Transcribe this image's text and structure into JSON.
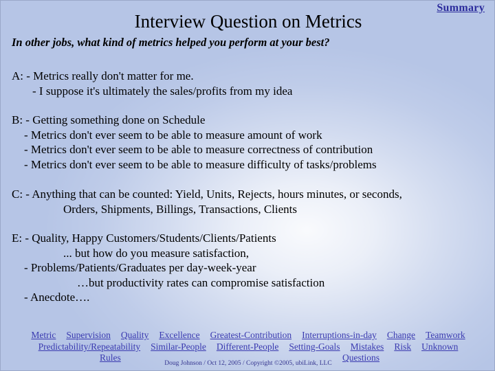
{
  "header": {
    "title": "Interview Question on Metrics",
    "summary_link": "Summary",
    "subtitle": "In other jobs, what kind of metrics helped you perform at your best?"
  },
  "body": {
    "block_a": {
      "lines": [
        "A: - Metrics really don't matter for me.",
        "- I suppose it's ultimately the sales/profits from my idea"
      ]
    },
    "block_b": {
      "lines": [
        "B: - Getting something done on Schedule",
        "- Metrics don't ever seem to be able to measure amount of work",
        "- Metrics don't ever seem to be able to measure correctness of contribution",
        "- Metrics don't ever seem to be able to measure difficulty of tasks/problems"
      ]
    },
    "block_c": {
      "lines": [
        "C: - Anything that can be counted:  Yield, Units, Rejects, hours minutes, or seconds,",
        "Orders, Shipments, Billings, Transactions, Clients"
      ]
    },
    "block_e": {
      "lines": [
        "E: - Quality, Happy Customers/Students/Clients/Patients",
        "... but how do you measure satisfaction,",
        "- Problems/Patients/Graduates per day-week-year",
        "…but productivity rates can compromise satisfaction",
        "- Anecdote…."
      ]
    }
  },
  "footer": {
    "row1": [
      "Metric",
      "Supervision",
      "Quality",
      "Excellence",
      "Greatest-Contribution",
      "Interruptions-in-day",
      "Change",
      "Teamwork"
    ],
    "row2": [
      "Predictability/Repeatability",
      "Similar-People",
      "Different-People",
      "Setting-Goals",
      "Mistakes",
      "Risk",
      "Unknown"
    ],
    "rules_link": "Rules",
    "questions_link": "Questions",
    "copyright": "Doug Johnson / Oct 12, 2005  / Copyright ©2005, ubiLink, LLC"
  },
  "colors": {
    "background": "#b6c5e6",
    "link": "#3a3ab0",
    "summary_link": "#2b2b9c",
    "text": "#000000",
    "copyright": "#34348f"
  }
}
